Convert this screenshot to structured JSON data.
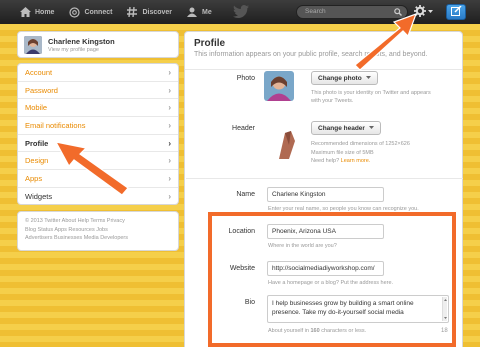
{
  "topnav": {
    "items": [
      {
        "label": "Home",
        "icon": "home-icon"
      },
      {
        "label": "Connect",
        "icon": "at-icon"
      },
      {
        "label": "Discover",
        "icon": "hashtag-icon"
      },
      {
        "label": "Me",
        "icon": "person-icon"
      }
    ],
    "search_placeholder": "Search",
    "accent": "#2a7bc6"
  },
  "user": {
    "name": "Charlene Kingston",
    "sub": "View my profile page"
  },
  "menu": {
    "items": [
      {
        "label": "Account",
        "active": false
      },
      {
        "label": "Password",
        "active": false
      },
      {
        "label": "Mobile",
        "active": false
      },
      {
        "label": "Email notifications",
        "active": false
      },
      {
        "label": "Profile",
        "active": true
      },
      {
        "label": "Design",
        "active": false
      },
      {
        "label": "Apps",
        "active": false
      },
      {
        "label": "Widgets",
        "active": false
      }
    ],
    "link_color": "#e98a00"
  },
  "footer": {
    "line1": "© 2013 Twitter  About  Help  Terms  Privacy",
    "line2": "Blog  Status  Apps  Resources  Jobs",
    "line3": "Advertisers  Businesses  Media  Developers"
  },
  "profile": {
    "title": "Profile",
    "subtitle": "This information appears on your public profile, search results, and beyond.",
    "photo": {
      "label": "Photo",
      "button": "Change photo",
      "hint1": "This photo is your identity on Twitter and appears",
      "hint2": "with your Tweets."
    },
    "header": {
      "label": "Header",
      "button": "Change header",
      "hint1": "Recommended dimensions of 1252×626",
      "hint2": "Maximum file size of 5MB",
      "hint3": "Need help?",
      "learn_more": "Learn more."
    },
    "name": {
      "label": "Name",
      "value": "Charlene Kingston",
      "hint": "Enter your real name, so people you know can recognize you."
    },
    "location": {
      "label": "Location",
      "value": "Phoenix, Arizona USA",
      "hint": "Where in the world are you?"
    },
    "website": {
      "label": "Website",
      "value": "http://socialmediadiyworkshop.com/",
      "hint": "Have a homepage or a blog? Put the address here."
    },
    "bio": {
      "label": "Bio",
      "value_line1": "I help businesses grow by building a smart online",
      "value_line2": "presence. Take my do-it-yourself social media",
      "hint_prefix": "About yourself in",
      "hint_count": "160",
      "hint_suffix": "characters or less.",
      "remaining": "18"
    }
  },
  "annotation_color": "#f26b2a"
}
